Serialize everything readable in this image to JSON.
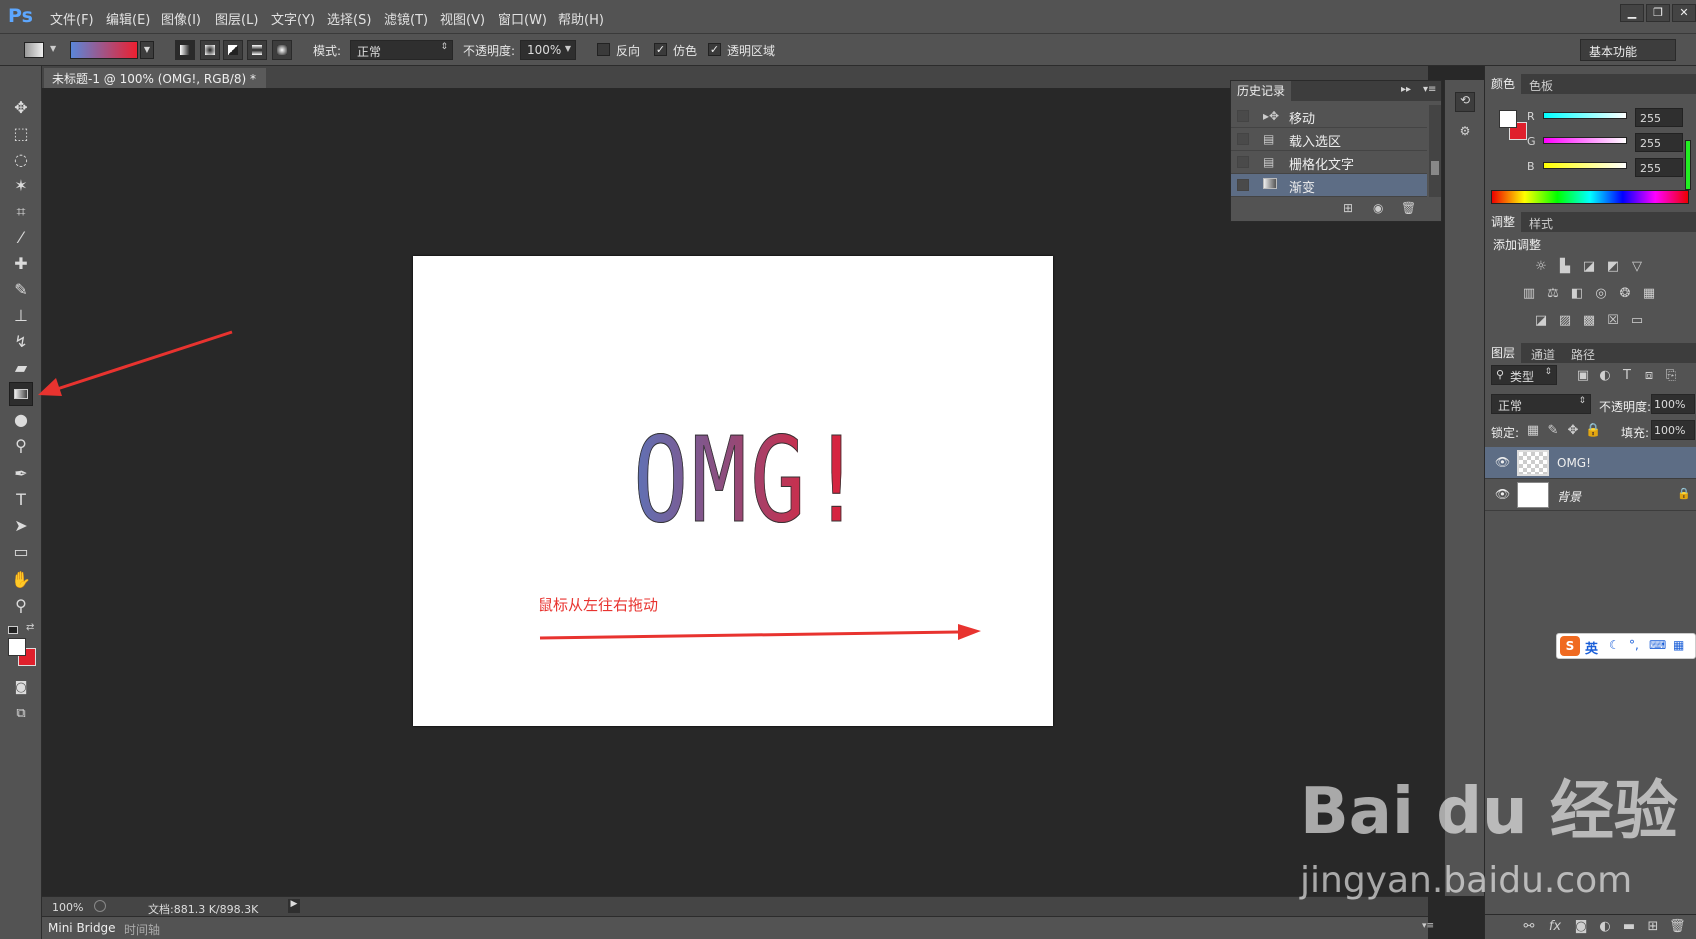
{
  "app": {
    "logo": "Ps"
  },
  "menu": [
    "文件(F)",
    "编辑(E)",
    "图像(I)",
    "图层(L)",
    "文字(Y)",
    "选择(S)",
    "滤镜(T)",
    "视图(V)",
    "窗口(W)",
    "帮助(H)"
  ],
  "window_controls": {
    "minimize": "▁",
    "restore": "❐",
    "close": "✕"
  },
  "options": {
    "mode_label": "模式:",
    "mode_value": "正常",
    "opacity_label": "不透明度:",
    "opacity_value": "100%",
    "reverse_label": "反向",
    "dither_label": "仿色",
    "transparency_label": "透明区域",
    "reverse_checked": false,
    "dither_checked": true,
    "transparency_checked": true,
    "workspace": "基本功能"
  },
  "document": {
    "tab_title": "未标题-1 @ 100% (OMG!, RGB/8) *",
    "tab_close": "×",
    "text": "OMG!",
    "note": "鼠标从左往右拖动"
  },
  "status": {
    "zoom": "100%",
    "doc_info": "文档:881.3 K/898.3K"
  },
  "bottom_tabs": [
    "Mini Bridge",
    "时间轴"
  ],
  "history": {
    "title": "历史记录",
    "items": [
      {
        "label": "移动",
        "icon": "move-icon"
      },
      {
        "label": "载入选区",
        "icon": "document-icon"
      },
      {
        "label": "栅格化文字",
        "icon": "document-icon"
      },
      {
        "label": "渐变",
        "icon": "gradient-icon"
      }
    ],
    "selected_index": 3
  },
  "color_panel": {
    "tabs": [
      "颜色",
      "色板"
    ],
    "channels": [
      {
        "name": "R",
        "value": "255"
      },
      {
        "name": "G",
        "value": "255"
      },
      {
        "name": "B",
        "value": "255"
      }
    ]
  },
  "adjust_panel": {
    "tabs": [
      "调整",
      "样式"
    ],
    "title": "添加调整"
  },
  "layers_panel": {
    "tabs": [
      "图层",
      "通道",
      "路径"
    ],
    "filter_label": "类型",
    "blend_mode": "正常",
    "opacity_label": "不透明度:",
    "opacity_value": "100%",
    "lock_label": "锁定:",
    "fill_label": "填充:",
    "fill_value": "100%",
    "layers": [
      {
        "name": "OMG!"
      },
      {
        "name": "背景"
      }
    ]
  },
  "ime": {
    "lang": "英"
  },
  "watermark": {
    "main": "Bai du 经验",
    "url": "jingyan.baidu.com"
  },
  "colors": {
    "accent_red": "#e8332f",
    "selection_blue": "#5d6d85",
    "foreground": "#ffffff",
    "background": "#e0202c"
  }
}
